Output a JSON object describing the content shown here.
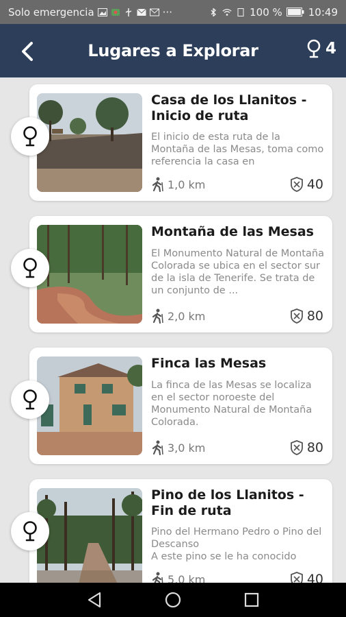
{
  "status_bar": {
    "carrier": "Solo emergencia",
    "more": "···",
    "battery": "100 %",
    "time": "10:49"
  },
  "app_bar": {
    "title": "Lugares a Explorar",
    "count": "4",
    "back_icon": "arrow-left-icon",
    "count_icon": "map-pin-icon"
  },
  "places": [
    {
      "title": "Casa de los Llanitos - Inicio de ruta",
      "description": "El inicio de esta ruta de la Montaña de las Mesas, toma como referencia la casa en",
      "distance": "1,0 km",
      "points": "40"
    },
    {
      "title": "Montaña de las Mesas",
      "description": "El Monumento Natural de Montaña Colorada se ubica en el sector sur de la isla de Tenerife. Se trata de un conjunto de ...",
      "distance": "2,0 km",
      "points": "80"
    },
    {
      "title": "Finca las Mesas",
      "description": "La finca de las Mesas se localiza en el sector noroeste del Monumento Natural de Montaña Colorada.",
      "distance": "3,0 km",
      "points": "80"
    },
    {
      "title": "Pino de los Llanitos - Fin de ruta",
      "description": "Pino del Hermano Pedro o Pino del Descanso\nA este pino se le ha conocido",
      "distance": "5,0 km",
      "points": "40"
    }
  ],
  "nav": {
    "back_icon": "triangle-back-icon",
    "home_icon": "circle-home-icon",
    "recents_icon": "square-recents-icon"
  },
  "colors": {
    "app_bar": "#2c3e59",
    "status_bar": "#6a6a6a",
    "background": "#e6e6e6"
  }
}
